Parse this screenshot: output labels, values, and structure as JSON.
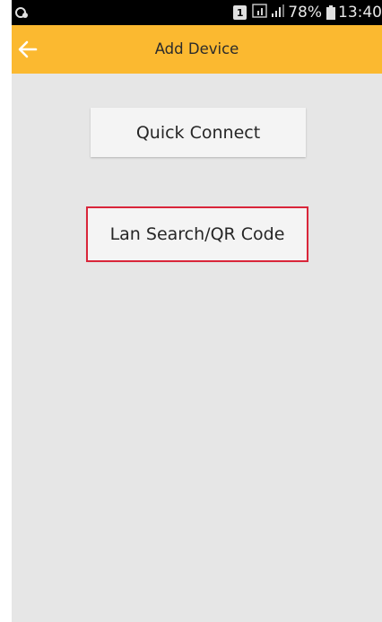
{
  "status_bar": {
    "sim_label": "1",
    "battery_percent": "78%",
    "time": "13:40"
  },
  "app_bar": {
    "title": "Add Device",
    "back_icon": "arrow-left-icon"
  },
  "actions": {
    "quick_connect_label": "Quick Connect",
    "lan_search_label": "Lan Search/QR Code"
  },
  "colors": {
    "app_bar": "#fbb930",
    "background": "#e6e6e6",
    "highlight": "#d9263a"
  }
}
